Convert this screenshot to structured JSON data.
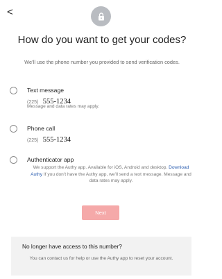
{
  "header": {
    "back_label": "<",
    "title": "How do you want to get your codes?",
    "subtitle": "We’ll use the phone number you provided to send verification codes."
  },
  "options": [
    {
      "label": "Text message",
      "area_code": "(225)",
      "number": "555-1234",
      "note": "Message and data rates may apply."
    },
    {
      "label": "Phone call",
      "area_code": "(225)",
      "number": "555-1234"
    },
    {
      "label": "Authenticator app",
      "desc_before": "We support the Authy app. Available for iOS, Android and desktop.",
      "link_text": "Download Authy",
      "desc_after": "If you don’t have the Authy app, we’ll send a text message. Message and data rates may apply."
    }
  ],
  "next_button": {
    "label": "Next"
  },
  "no_access": {
    "title": "No longer have access to this number?",
    "body": "You can contact us for help or use the Authy app to reset your account."
  },
  "colors": {
    "accent_disabled": "#f5a9a9",
    "link": "#2a5db0",
    "lock_circle": "#b9bcc1"
  },
  "icons": [
    "back-chevron-icon",
    "lock-icon"
  ]
}
